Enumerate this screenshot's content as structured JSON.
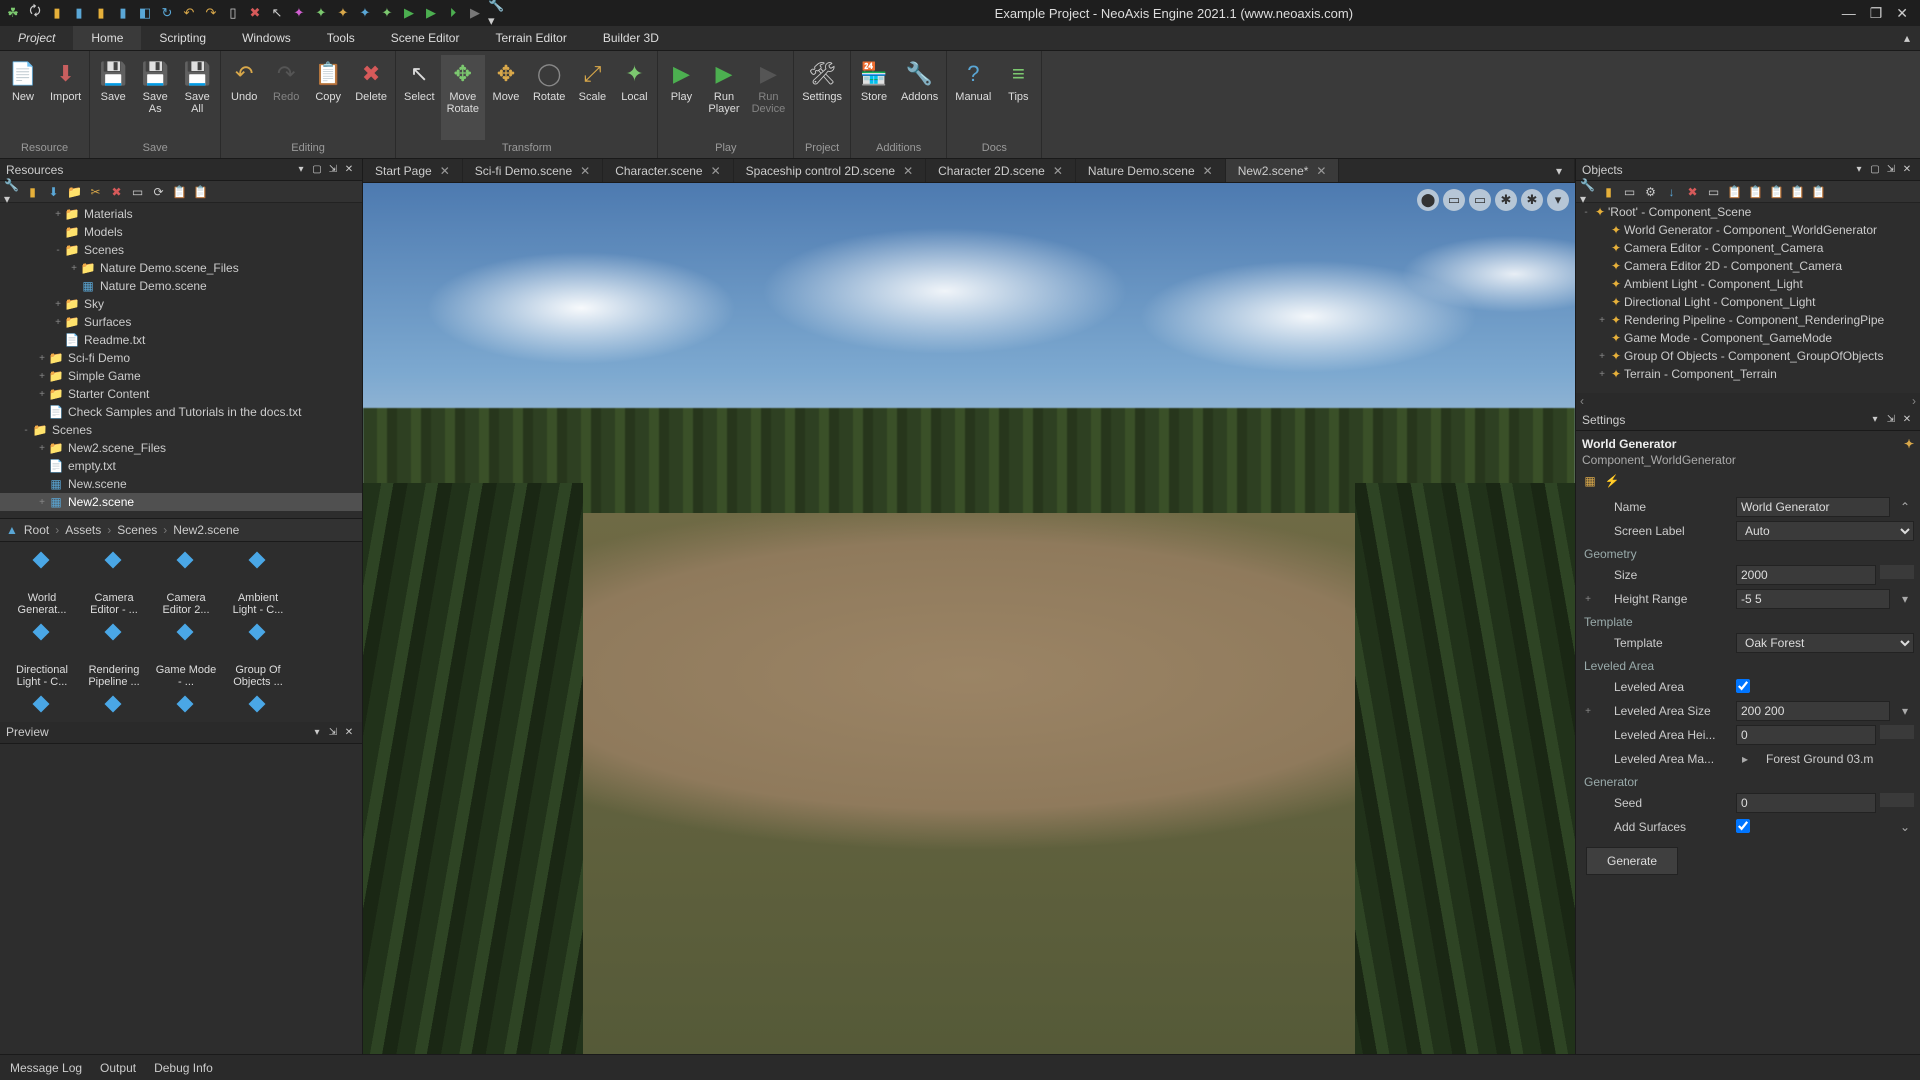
{
  "title": "Example Project - NeoAxis Engine 2021.1 (www.neoaxis.com)",
  "qat_icons": [
    "leaf",
    "reload",
    "new-doc",
    "block-b",
    "block-y",
    "block-w",
    "cube",
    "reload2",
    "undo",
    "redo",
    "page",
    "x",
    "arrow",
    "axis-p",
    "axis-g",
    "axis-o",
    "axis-b",
    "axis-g2",
    "play-g",
    "play-g2",
    "play-f",
    "play-d",
    "wrench"
  ],
  "menu": {
    "project": "Project",
    "tabs": [
      "Home",
      "Scripting",
      "Windows",
      "Tools",
      "Scene Editor",
      "Terrain Editor",
      "Builder 3D"
    ],
    "active": "Home"
  },
  "ribbon": {
    "groups": [
      {
        "label": "Resource",
        "buttons": [
          {
            "id": "new",
            "label": "New",
            "icon": "📄",
            "color": "#7cc86f"
          },
          {
            "id": "import",
            "label": "Import",
            "icon": "⬇",
            "color": "#c85f5f"
          }
        ]
      },
      {
        "label": "Save",
        "buttons": [
          {
            "id": "save",
            "label": "Save",
            "icon": "💾",
            "color": "#5aa7d6"
          },
          {
            "id": "save-as",
            "label": "Save\nAs",
            "icon": "💾",
            "color": "#5aa7d6"
          },
          {
            "id": "save-all",
            "label": "Save\nAll",
            "icon": "💾",
            "color": "#5aa7d6"
          }
        ]
      },
      {
        "label": "Editing",
        "buttons": [
          {
            "id": "undo",
            "label": "Undo",
            "icon": "↶",
            "color": "#d9a84a"
          },
          {
            "id": "redo",
            "label": "Redo",
            "icon": "↷",
            "color": "#777",
            "disabled": true
          },
          {
            "id": "copy",
            "label": "Copy",
            "icon": "📋",
            "color": "#ccc"
          },
          {
            "id": "delete",
            "label": "Delete",
            "icon": "✖",
            "color": "#d65a5a"
          }
        ]
      },
      {
        "label": "Transform",
        "buttons": [
          {
            "id": "select",
            "label": "Select",
            "icon": "↖",
            "color": "#ddd"
          },
          {
            "id": "move-rotate",
            "label": "Move\nRotate",
            "icon": "✥",
            "color": "#7cc86f",
            "active": true
          },
          {
            "id": "move",
            "label": "Move",
            "icon": "✥",
            "color": "#d9a84a"
          },
          {
            "id": "rotate",
            "label": "Rotate",
            "icon": "◯",
            "color": "#888"
          },
          {
            "id": "scale",
            "label": "Scale",
            "icon": "⤢",
            "color": "#d9a84a"
          },
          {
            "id": "local",
            "label": "Local",
            "icon": "✦",
            "color": "#7cc86f"
          }
        ]
      },
      {
        "label": "Play",
        "buttons": [
          {
            "id": "play",
            "label": "Play",
            "icon": "▶",
            "color": "#4caf50"
          },
          {
            "id": "run-player",
            "label": "Run\nPlayer",
            "icon": "▶",
            "color": "#4caf50"
          },
          {
            "id": "run-device",
            "label": "Run\nDevice",
            "icon": "▶",
            "color": "#777",
            "disabled": true
          }
        ]
      },
      {
        "label": "Project",
        "buttons": [
          {
            "id": "settings",
            "label": "Settings",
            "icon": "🛠",
            "color": "#ccc"
          }
        ]
      },
      {
        "label": "Additions",
        "buttons": [
          {
            "id": "store",
            "label": "Store",
            "icon": "🏪",
            "color": "#d9a84a"
          },
          {
            "id": "addons",
            "label": "Addons",
            "icon": "🔧",
            "color": "#5aa7d6"
          }
        ]
      },
      {
        "label": "Docs",
        "buttons": [
          {
            "id": "manual",
            "label": "Manual",
            "icon": "?",
            "color": "#5aa7d6"
          },
          {
            "id": "tips",
            "label": "Tips",
            "icon": "≡",
            "color": "#7cc86f"
          }
        ]
      }
    ]
  },
  "resources_panel": {
    "title": "Resources",
    "tree": [
      {
        "d": 3,
        "t": "+",
        "ic": "folder-y",
        "l": "Materials"
      },
      {
        "d": 3,
        "t": "",
        "ic": "folder-y",
        "l": "Models"
      },
      {
        "d": 3,
        "t": "-",
        "ic": "folder-y",
        "l": "Scenes"
      },
      {
        "d": 4,
        "t": "+",
        "ic": "folder-y",
        "l": "Nature Demo.scene_Files"
      },
      {
        "d": 4,
        "t": "",
        "ic": "file-b",
        "l": "Nature Demo.scene"
      },
      {
        "d": 3,
        "t": "+",
        "ic": "folder-y",
        "l": "Sky"
      },
      {
        "d": 3,
        "t": "+",
        "ic": "folder-y",
        "l": "Surfaces"
      },
      {
        "d": 3,
        "t": "",
        "ic": "file-w",
        "l": "Readme.txt"
      },
      {
        "d": 2,
        "t": "+",
        "ic": "folder-y",
        "l": "Sci-fi Demo"
      },
      {
        "d": 2,
        "t": "+",
        "ic": "folder-y",
        "l": "Simple Game"
      },
      {
        "d": 2,
        "t": "+",
        "ic": "folder-y",
        "l": "Starter Content"
      },
      {
        "d": 2,
        "t": "",
        "ic": "file-w",
        "l": "Check Samples and Tutorials in the docs.txt"
      },
      {
        "d": 1,
        "t": "-",
        "ic": "folder-g",
        "l": "Scenes"
      },
      {
        "d": 2,
        "t": "+",
        "ic": "folder-y",
        "l": "New2.scene_Files"
      },
      {
        "d": 2,
        "t": "",
        "ic": "file-w",
        "l": "empty.txt"
      },
      {
        "d": 2,
        "t": "",
        "ic": "file-b",
        "l": "New.scene"
      },
      {
        "d": 2,
        "t": "+",
        "ic": "file-b",
        "l": "New2.scene",
        "sel": true
      }
    ]
  },
  "breadcrumb": [
    "Root",
    "Assets",
    "Scenes",
    "New2.scene"
  ],
  "thumbs": [
    {
      "l": "World Generat..."
    },
    {
      "l": "Camera Editor - ..."
    },
    {
      "l": "Camera Editor 2..."
    },
    {
      "l": "Ambient Light - C..."
    },
    {
      "l": "Directional Light - C..."
    },
    {
      "l": "Rendering Pipeline ..."
    },
    {
      "l": "Game Mode - ..."
    },
    {
      "l": "Group Of Objects ..."
    },
    {
      "l": ""
    },
    {
      "l": ""
    },
    {
      "l": ""
    },
    {
      "l": ""
    }
  ],
  "preview_title": "Preview",
  "doc_tabs": [
    {
      "l": "Start Page"
    },
    {
      "l": "Sci-fi Demo.scene"
    },
    {
      "l": "Character.scene"
    },
    {
      "l": "Spaceship control 2D.scene"
    },
    {
      "l": "Character 2D.scene"
    },
    {
      "l": "Nature Demo.scene"
    },
    {
      "l": "New2.scene*",
      "active": true
    }
  ],
  "viewport_icons": [
    "⬤",
    "▭",
    "▭",
    "✱",
    "✱",
    "▾"
  ],
  "objects_panel": {
    "title": "Objects",
    "tree": [
      {
        "d": 0,
        "t": "-",
        "l": "'Root' - Component_Scene"
      },
      {
        "d": 1,
        "t": "",
        "l": "World Generator - Component_WorldGenerator"
      },
      {
        "d": 1,
        "t": "",
        "l": "Camera Editor - Component_Camera"
      },
      {
        "d": 1,
        "t": "",
        "l": "Camera Editor 2D - Component_Camera"
      },
      {
        "d": 1,
        "t": "",
        "l": "Ambient Light - Component_Light"
      },
      {
        "d": 1,
        "t": "",
        "l": "Directional Light - Component_Light"
      },
      {
        "d": 1,
        "t": "+",
        "l": "Rendering Pipeline - Component_RenderingPipe"
      },
      {
        "d": 1,
        "t": "",
        "l": "Game Mode - Component_GameMode"
      },
      {
        "d": 1,
        "t": "+",
        "l": "Group Of Objects - Component_GroupOfObjects"
      },
      {
        "d": 1,
        "t": "+",
        "l": "Terrain - Component_Terrain"
      }
    ]
  },
  "settings": {
    "title": "Settings",
    "heading": "World Generator",
    "subtype": "Component_WorldGenerator",
    "props": {
      "name": {
        "label": "Name",
        "value": "World Generator"
      },
      "screen_label": {
        "label": "Screen Label",
        "value": "Auto"
      },
      "geom_h": "Geometry",
      "size": {
        "label": "Size",
        "value": "2000"
      },
      "height_range": {
        "label": "Height Range",
        "value": "-5 5",
        "exp": "+"
      },
      "tmpl_h": "Template",
      "template": {
        "label": "Template",
        "value": "Oak Forest"
      },
      "lvl_h": "Leveled Area",
      "lvl_area": {
        "label": "Leveled Area",
        "checked": true
      },
      "lvl_size": {
        "label": "Leveled Area Size",
        "value": "200 200",
        "exp": "+"
      },
      "lvl_height": {
        "label": "Leveled Area Hei...",
        "value": "0"
      },
      "lvl_mat": {
        "label": "Leveled Area Ma...",
        "value": "Forest Ground 03.m"
      },
      "gen_h": "Generator",
      "seed": {
        "label": "Seed",
        "value": "0"
      },
      "add_surfaces": {
        "label": "Add Surfaces",
        "checked": true
      },
      "generate_btn": "Generate"
    }
  },
  "status": [
    "Message Log",
    "Output",
    "Debug Info"
  ]
}
